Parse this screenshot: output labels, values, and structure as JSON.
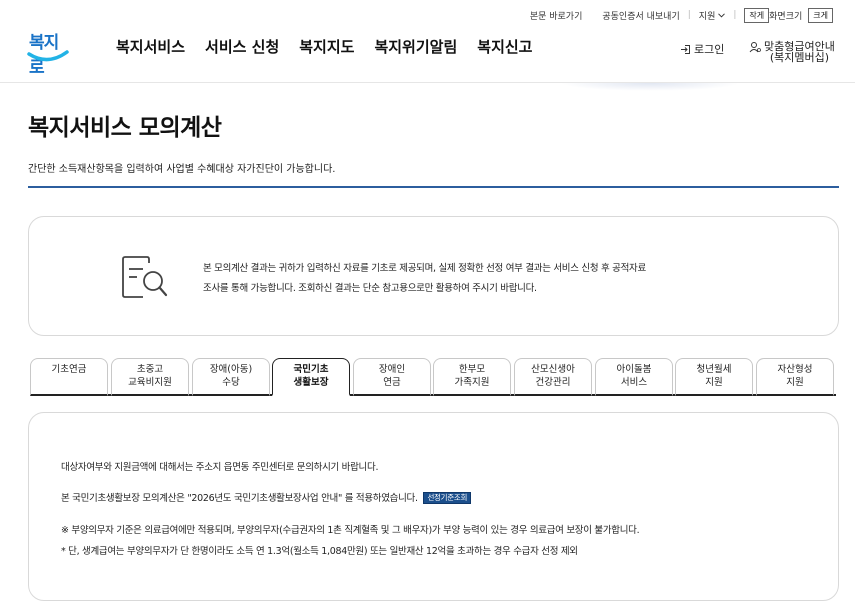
{
  "util": {
    "skip": "본문 바로가기",
    "cert": "공동인증서 내보내기",
    "region": "지원",
    "zoom_small": "작게",
    "zoom_label": "화면크기",
    "zoom_large": "크게"
  },
  "header": {
    "logo": "복지로",
    "nav": [
      "복지서비스",
      "서비스 신청",
      "복지지도",
      "복지위기알림",
      "복지신고"
    ],
    "login": "로그인",
    "benefit_line1": "맞춤형급여안내",
    "benefit_line2": "(복지멤버십)"
  },
  "page": {
    "title": "복지서비스 모의계산",
    "desc": "간단한 소득재산항목을 입력하여 사업별 수혜대상 자가진단이 가능합니다."
  },
  "notice": {
    "line1": "본 모의계산 결과는 귀하가 입력하신 자료를 기초로 제공되며, 실제 정확한 선정 여부 결과는 서비스 신청 후 공적자료",
    "line2": "조사를 통해 가능합니다. 조회하신 결과는 단순 참고용으로만 활용하여 주시기 바랍니다."
  },
  "tabs": [
    {
      "l1": "기초연금",
      "l2": ""
    },
    {
      "l1": "초중고",
      "l2": "교육비지원"
    },
    {
      "l1": "장애(아동)",
      "l2": "수당"
    },
    {
      "l1": "국민기초",
      "l2": "생활보장"
    },
    {
      "l1": "장애인",
      "l2": "연금"
    },
    {
      "l1": "한부모",
      "l2": "가족지원"
    },
    {
      "l1": "산모신생아",
      "l2": "건강관리"
    },
    {
      "l1": "아이돌봄",
      "l2": "서비스"
    },
    {
      "l1": "청년월세",
      "l2": "지원"
    },
    {
      "l1": "자산형성",
      "l2": "지원"
    }
  ],
  "active_tab_index": 3,
  "content": {
    "line1": "대상자여부와 지원금액에 대해서는 주소지 읍면동 주민센터로 문의하시기 바랍니다.",
    "line2": "본 국민기초생활보장 모의계산은 \"2026년도 국민기초생활보장사업 안내\" 를 적용하였습니다.",
    "std_button": "선정기준조회",
    "line3": "※ 부양의무자 기준은 의료급여에만 적용되며, 부양의무자(수급권자의 1촌 직계혈족 및 그 배우자)가 부양 능력이 있는 경우 의료급여 보장이 불가합니다.",
    "line4": "* 단, 생계급여는 부양의무자가 단 한명이라도 소득 연 1.3억(월소득 1,084만원) 또는 일반재산 12억을 초과하는 경우 수급자 선정 제외"
  },
  "colors": {
    "brand_blue": "#1a73c7",
    "title_line": "#2c5e9e",
    "std_button_bg": "#1c4f8c"
  }
}
